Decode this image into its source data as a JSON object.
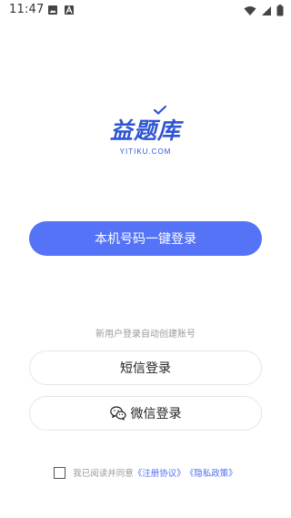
{
  "status_bar": {
    "time": "11:47",
    "left_icons": [
      "image-icon",
      "a-font-icon"
    ],
    "right_icons": [
      "wifi-icon",
      "signal-icon",
      "battery-icon"
    ]
  },
  "logo": {
    "title": "益题库",
    "subtitle": "YITIKU.COM"
  },
  "login": {
    "one_click_label": "本机号码一键登录",
    "hint": "新用户登录自动创建账号",
    "sms_label": "短信登录",
    "wechat_label": "微信登录"
  },
  "agreement": {
    "prefix": "我已阅读并同意",
    "terms_link": "《注册协议》",
    "privacy_link": "《隐私政策》",
    "checked": false
  },
  "colors": {
    "primary": "#5473f7",
    "brand": "#2f55d4",
    "link": "#4e6ef2"
  }
}
